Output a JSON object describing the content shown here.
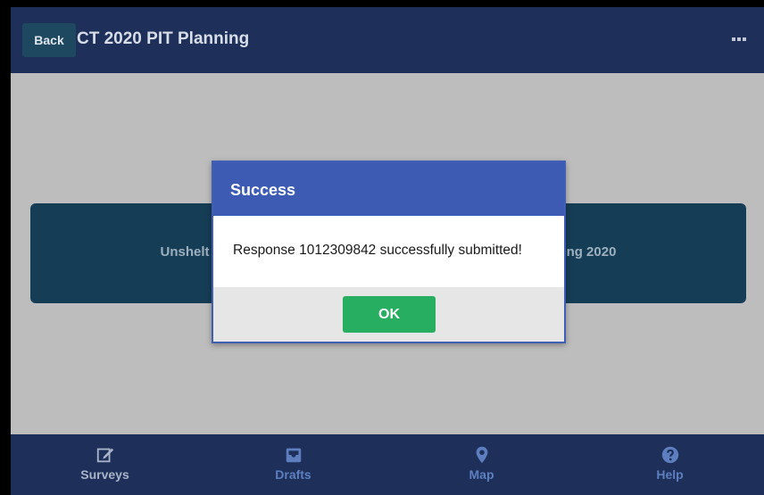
{
  "header": {
    "back_label": "Back",
    "title": "CT 2020 PIT Planning",
    "menu_icon": "more-icon"
  },
  "survey_card": {
    "label_left": "Unshelt",
    "label_right": "ng 2020"
  },
  "dialog": {
    "title": "Success",
    "message": "Response 1012309842 successfully submitted!",
    "ok_label": "OK"
  },
  "bottom_nav": {
    "items": [
      {
        "label": "Surveys",
        "icon": "edit-icon",
        "active": true
      },
      {
        "label": "Drafts",
        "icon": "inbox-icon",
        "active": false
      },
      {
        "label": "Map",
        "icon": "map-pin-icon",
        "active": false
      },
      {
        "label": "Help",
        "icon": "help-icon",
        "active": false
      }
    ]
  },
  "colors": {
    "header_bg": "#1e2f5a",
    "dialog_header": "#3d5bb3",
    "ok_button": "#27ae60",
    "card_bg": "#163d56"
  }
}
